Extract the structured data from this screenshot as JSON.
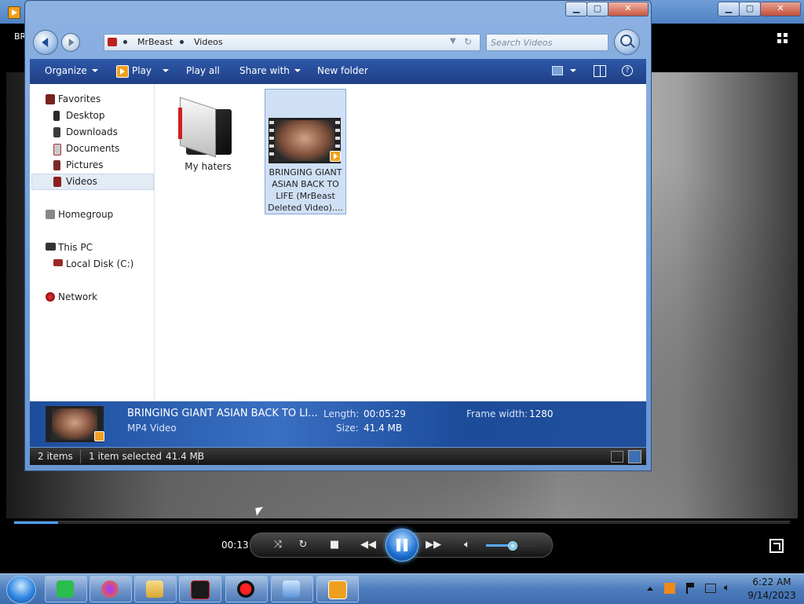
{
  "player": {
    "title_fragment": "BR",
    "current_time": "00:13",
    "progress_fraction": 0.057,
    "volume_fraction": 0.5
  },
  "explorer": {
    "address": {
      "crumbs": [
        "MrBeast",
        "Videos"
      ]
    },
    "search": {
      "placeholder": "Search Videos"
    },
    "toolbar": {
      "organize": "Organize",
      "play": "Play",
      "play_all": "Play all",
      "share_with": "Share with",
      "new_folder": "New folder"
    },
    "nav_pane": {
      "favorites": "Favorites",
      "desktop": "Desktop",
      "downloads": "Downloads",
      "documents": "Documents",
      "pictures": "Pictures",
      "videos": "Videos",
      "homegroup": "Homegroup",
      "this_pc": "This PC",
      "local_disk": "Local Disk (C:)",
      "network": "Network",
      "selected": "Videos"
    },
    "items": [
      {
        "name": "My haters",
        "type": "folder"
      },
      {
        "name": "BRINGING GIANT ASIAN BACK TO LIFE (MrBeast Deleted Video)....",
        "type": "video",
        "selected": true
      }
    ],
    "details": {
      "name": "BRINGING GIANT ASIAN BACK TO LI...",
      "type": "MP4 Video",
      "length_label": "Length:",
      "length_value": "00:05:29",
      "size_label": "Size:",
      "size_value": "41.4 MB",
      "frame_width_label": "Frame width:",
      "frame_width_value": "1280"
    },
    "status": {
      "items_count": "2 items",
      "selection": "1 item selected",
      "selection_size": "41.4 MB"
    }
  },
  "taskbar": {
    "time": "6:22 AM",
    "date": "9/14/2023"
  },
  "colors": {
    "accent": "#1f3f86",
    "selection": "#cfe0f5",
    "player_accent": "#4aa0ff",
    "taskbar": "#4d7cbc"
  },
  "icons": {
    "titlebar_min": "minimize-icon",
    "titlebar_max": "maximize-icon",
    "titlebar_close": "close-icon",
    "search": "search-icon",
    "refresh": "refresh-icon",
    "shuffle": "shuffle-icon",
    "repeat": "repeat-icon",
    "stop": "stop-icon",
    "previous": "previous-icon",
    "pause": "pause-icon",
    "next": "next-icon",
    "volume": "volume-icon",
    "fullscreen": "fullscreen-icon"
  }
}
